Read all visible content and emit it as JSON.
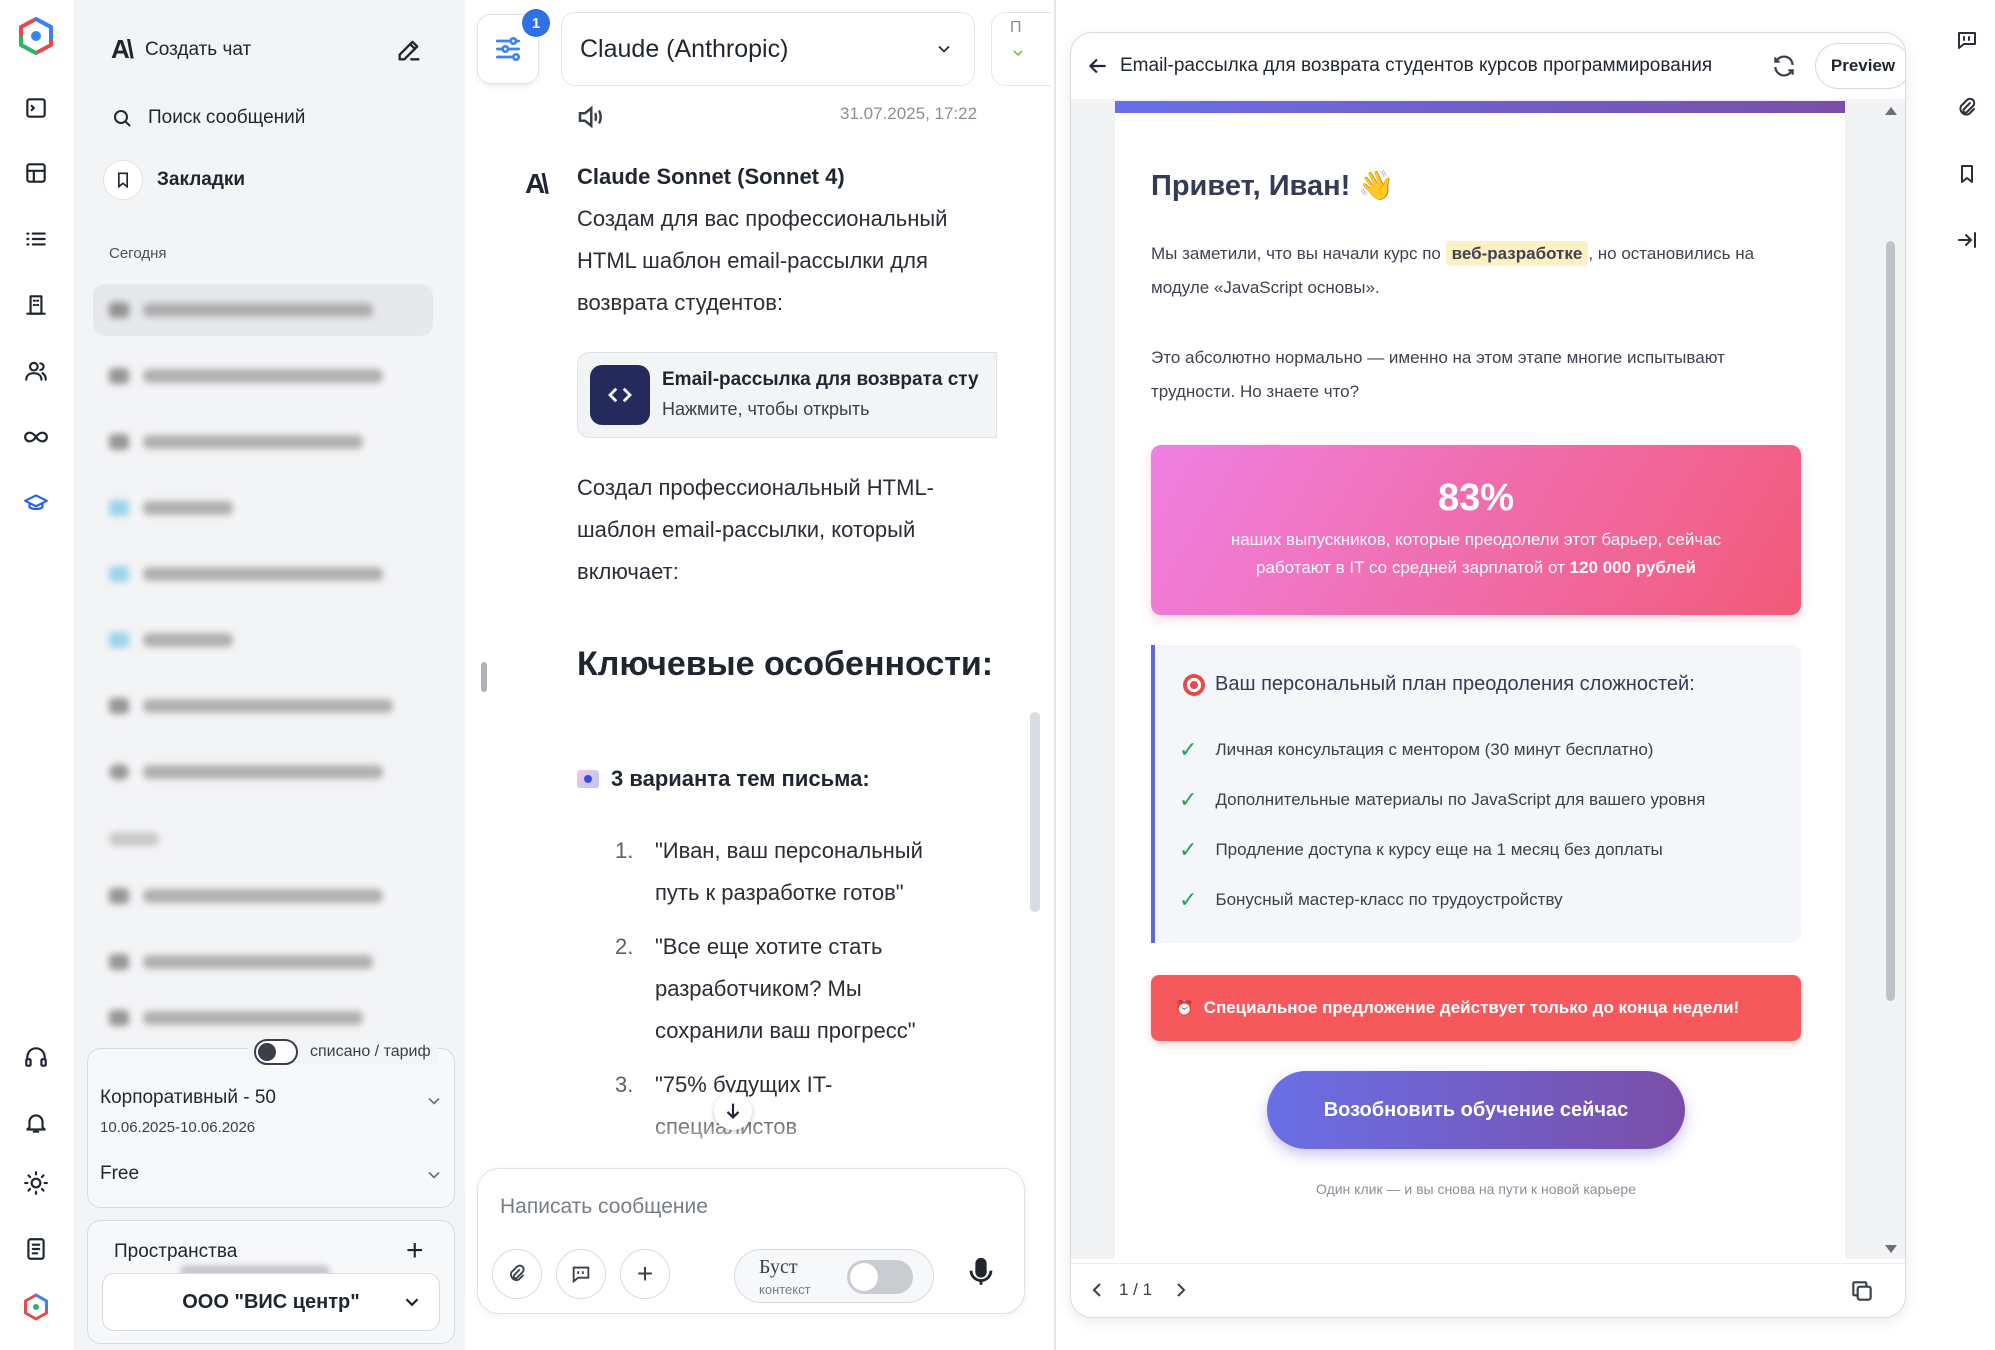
{
  "sidebar": {
    "new_chat_label": "Создать чат",
    "search_label": "Поиск сообщений",
    "bookmarks_label": "Закладки",
    "section_today": "Сегодня",
    "toggle_label": "списано / тариф",
    "plan_name": "Корпоративный - 50",
    "plan_dates": "10.06.2025-10.06.2026",
    "plan_tier": "Free",
    "spaces_label": "Пространства",
    "space_value": "ООО \"ВИС центр\""
  },
  "chat": {
    "settings_badge": "1",
    "model_name": "Claude (Anthropic)",
    "peek_tab": "П",
    "timestamp": "31.07.2025, 17:22",
    "assistant_name": "Claude Sonnet (Sonnet 4)",
    "intro": "Создам для вас профессиональный HTML шаблон email-рассылки для возврата студентов:",
    "artifact_title": "Email-рассылка для возврата сту",
    "artifact_sub": "Нажмите, чтобы открыть",
    "created_text": "Создал профессиональный HTML-шаблон email-рассылки, который включает:",
    "heading": "Ключевые особенности:",
    "subheading": "3 варианта тем письма:",
    "list": [
      {
        "num": "1.",
        "text": "\"Иван, ваш персональный путь к разработке готов\""
      },
      {
        "num": "2.",
        "text": "\"Все еще хотите стать разработчиком? Мы сохранили ваш прогресс\""
      },
      {
        "num": "3.",
        "text": "\"75% будущих IT-специалистов"
      }
    ],
    "input_placeholder": "Написать сообщение",
    "boost_label": "Буст",
    "boost_sub": "контекст"
  },
  "preview": {
    "title": "Email-рассылка для возврата студентов курсов программирования",
    "preview_button": "Preview",
    "greeting": "Привет, Иван! 👋",
    "p1_before": "Мы заметили, что вы начали курс по ",
    "p1_highlight": "веб-разработке",
    "p1_after": ", но остановились на модуле «JavaScript основы».",
    "p2": "Это абсолютно нормально — именно на этом этапе многие испытывают трудности. Но знаете что?",
    "stat_value": "83%",
    "stat_line1": "наших выпускников, которые преодолели этот барьер, сейчас",
    "stat_line2_before": "работают в IT со средней зарплатой от ",
    "stat_line2_bold": "120 000 рублей",
    "plan_title": "Ваш персональный план преодоления сложностей:",
    "plan_items": [
      "Личная консультация с ментором (30 минут бесплатно)",
      "Дополнительные материалы по JavaScript для вашего уровня",
      "Продление доступа к курсу еще на 1 месяц без доплаты",
      "Бонусный мастер-класс по трудоустройству"
    ],
    "offer": "Специальное предложение действует только до конца недели!",
    "cta": "Возобновить обучение сейчас",
    "footer_note": "Один клик — и вы снова на пути к новой карьере",
    "pager": "1 / 1"
  },
  "colors": {
    "accent": "#3b82f6",
    "stat_gradient_from": "#f07ee0",
    "stat_gradient_to": "#f4566d",
    "offer_bg": "#f6595c",
    "cta_from": "#6a6fe6",
    "cta_to": "#7a4ea8",
    "check": "#22a45d",
    "highlight": "#fdf0c2"
  }
}
